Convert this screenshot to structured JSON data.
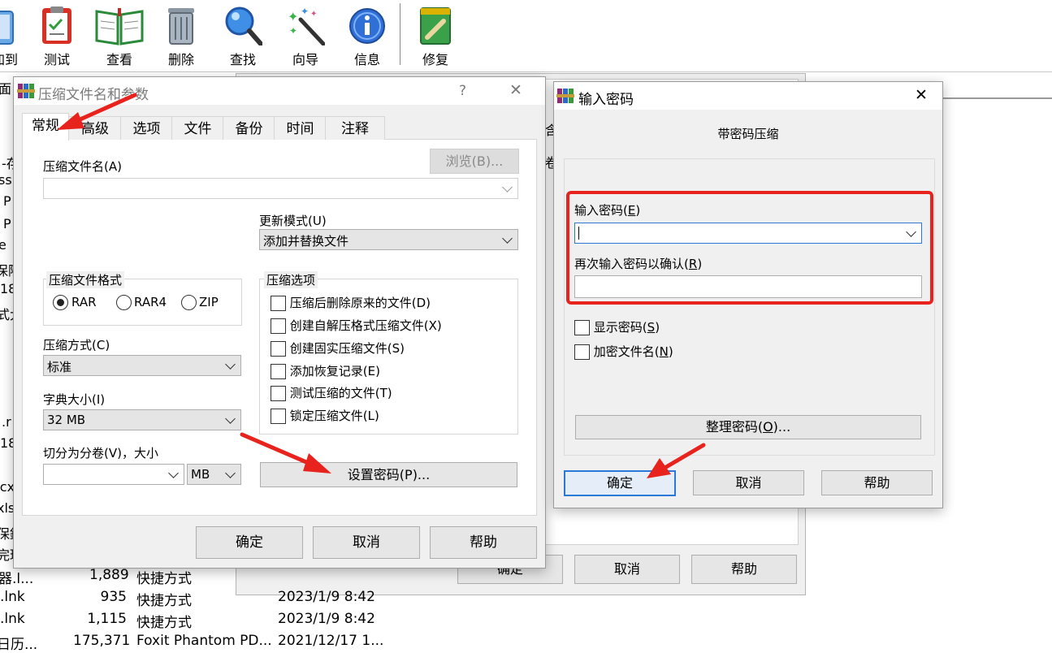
{
  "toolbar": {
    "buttons": [
      {
        "label": "添加到",
        "icon": "book-add-icon"
      },
      {
        "label": "测试",
        "icon": "clipboard-check-icon"
      },
      {
        "label": "查看",
        "icon": "open-book-icon"
      },
      {
        "label": "删除",
        "icon": "trash-icon"
      },
      {
        "label": "查找",
        "icon": "magnifier-icon"
      },
      {
        "label": "向导",
        "icon": "magic-wand-icon"
      },
      {
        "label": "信息",
        "icon": "info-icon"
      },
      {
        "label": "修复",
        "icon": "repair-icon"
      }
    ]
  },
  "background": {
    "left_fragments": [
      "面",
      "-存",
      "ss",
      "P",
      "P",
      "e",
      "保险",
      "18",
      "式大",
      ".r",
      "18",
      "ocx",
      "xls",
      "保鏡",
      "完理"
    ],
    "mid_fragments": [
      "含",
      "卷"
    ],
    "bottom_buttons": {
      "ok": "确定",
      "cancel": "取消",
      "help": "帮助"
    },
    "files": [
      {
        "name": "器.l...",
        "size": "1,889",
        "type": "快捷方式",
        "date": ""
      },
      {
        "name": ".lnk",
        "size": "935",
        "type": "快捷方式",
        "date": "2023/1/9 8:42"
      },
      {
        "name": ".lnk",
        "size": "1,115",
        "type": "快捷方式",
        "date": "2023/1/9 8:42"
      },
      {
        "name": "日历...",
        "size": "175,371",
        "type": "Foxit Phantom PD...",
        "date": "2021/12/17 1..."
      }
    ]
  },
  "archive_dialog": {
    "title": "压缩文件名和参数",
    "help_glyph": "?",
    "close_glyph": "✕",
    "tabs": [
      "常规",
      "高级",
      "选项",
      "文件",
      "备份",
      "时间",
      "注释"
    ],
    "active_tab": "常规",
    "archive_name_label": "压缩文件名(A)",
    "browse_button": "浏览(B)...",
    "archive_name_value": "",
    "update_mode_label": "更新模式(U)",
    "update_mode_value": "添加并替换文件",
    "format_group": "压缩文件格式",
    "formats": [
      "RAR",
      "RAR4",
      "ZIP"
    ],
    "selected_format": "RAR",
    "method_label": "压缩方式(C)",
    "method_value": "标准",
    "dict_label": "字典大小(I)",
    "dict_value": "32 MB",
    "split_label": "切分为分卷(V)，大小",
    "split_value": "",
    "split_unit": "MB",
    "options_group": "压缩选项",
    "options": [
      "压缩后删除原来的文件(D)",
      "创建自解压格式压缩文件(X)",
      "创建固实压缩文件(S)",
      "添加恢复记录(E)",
      "测试压缩的文件(T)",
      "锁定压缩文件(L)"
    ],
    "set_password_button": "设置密码(P)...",
    "ok": "确定",
    "cancel": "取消",
    "help": "帮助"
  },
  "password_dialog": {
    "title": "输入密码",
    "close_glyph": "✕",
    "heading": "带密码压缩",
    "enter_password_label": "输入密码",
    "enter_password_key": "E",
    "enter_password_value": "",
    "confirm_label": "再次输入密码以确认",
    "confirm_key": "R",
    "confirm_value": "",
    "show_password_label": "显示密码",
    "show_password_key": "S",
    "encrypt_names_label": "加密文件名",
    "encrypt_names_key": "N",
    "organize_label": "整理密码",
    "organize_key": "O",
    "organize_suffix": "...",
    "ok": "确定",
    "cancel": "取消",
    "help": "帮助"
  },
  "colors": {
    "annotation_red": "#e8221c",
    "dialog_bg": "#f0f0f0",
    "default_button_border": "#2a78d7"
  }
}
